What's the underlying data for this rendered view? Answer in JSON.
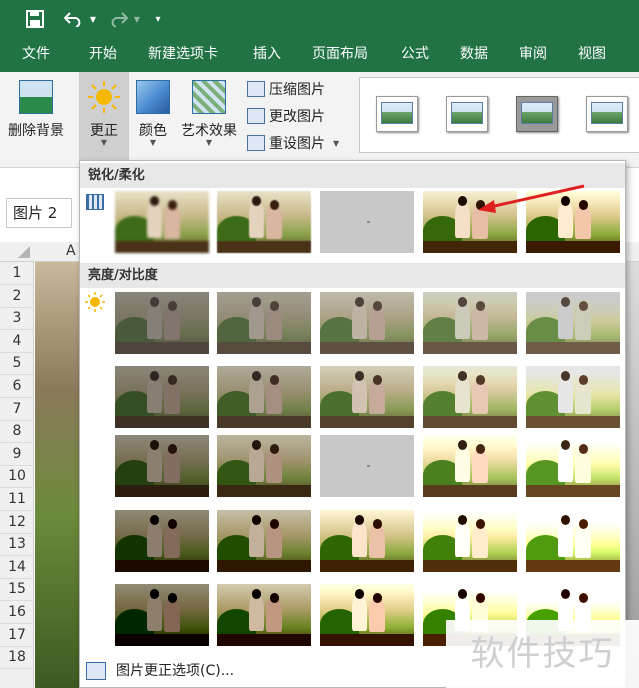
{
  "quick_access": {
    "save_icon": "save-icon",
    "undo_icon": "undo-icon",
    "redo_icon": "redo-icon",
    "customize_icon": "customize-qat-icon"
  },
  "tabs": [
    "文件",
    "开始",
    "新建选项卡",
    "插入",
    "页面布局",
    "公式",
    "数据",
    "审阅",
    "视图"
  ],
  "ribbon": {
    "remove_bg": "删除背景",
    "corrections": "更正",
    "color": "颜色",
    "artistic": "艺术效果",
    "compress": "压缩图片",
    "change": "更改图片",
    "reset": "重设图片"
  },
  "namebox": "图片 2",
  "column_header": "A",
  "row_numbers": [
    "1",
    "2",
    "3",
    "4",
    "5",
    "6",
    "7",
    "8",
    "9",
    "10",
    "11",
    "12",
    "13",
    "14",
    "15",
    "16",
    "17",
    "18"
  ],
  "dropdown": {
    "section1": "锐化/柔化",
    "section2": "亮度/对比度",
    "options_link": "图片更正选项(C)..."
  },
  "watermark": "软件技巧",
  "colors": {
    "brand": "#217346",
    "arrow": "#e02020"
  }
}
